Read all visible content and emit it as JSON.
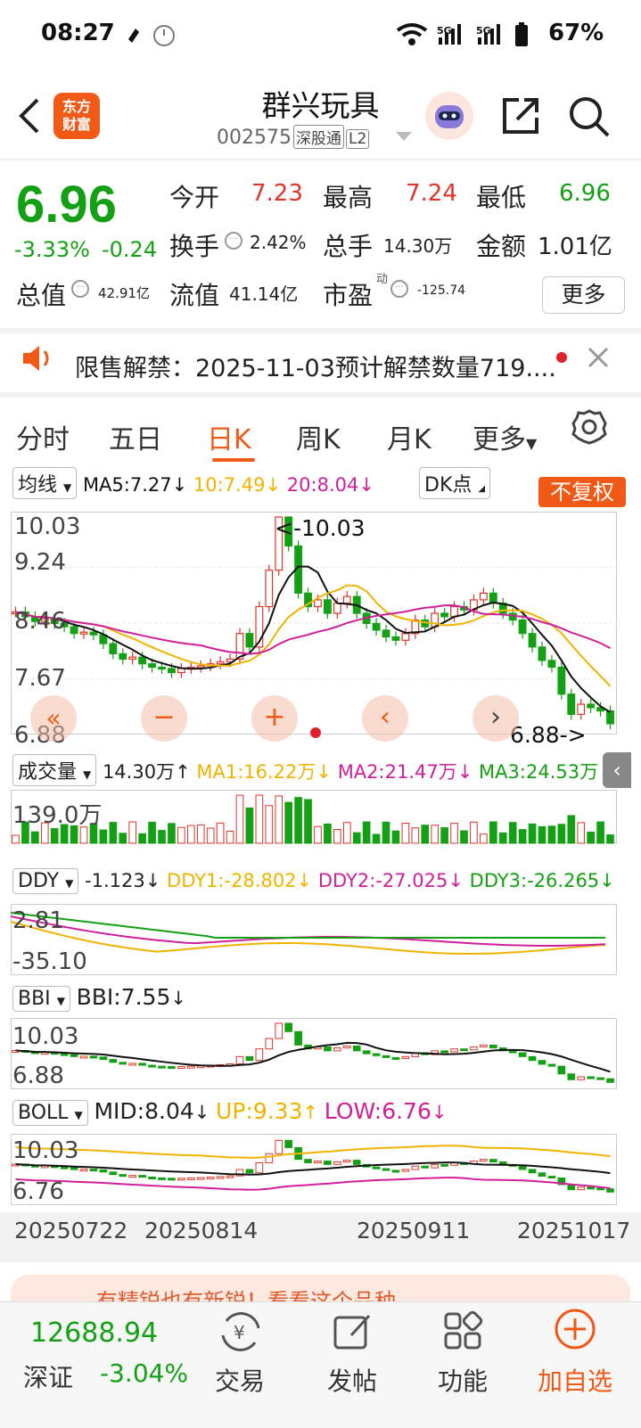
{
  "status": {
    "time": "08:27",
    "battery": "67%"
  },
  "header": {
    "title": "群兴玩具",
    "code": "002575",
    "tag1": "深股通",
    "tag2": "L2",
    "logo_l1": "东方",
    "logo_l2": "财富"
  },
  "quote": {
    "price": "6.96",
    "change_pct": "-3.33%",
    "change": "-0.24",
    "open_label": "今开",
    "open": "7.23",
    "high_label": "最高",
    "high": "7.24",
    "low_label": "最低",
    "low": "6.96",
    "turnover_label": "换手",
    "turnover": "2.42%",
    "volume_label": "总手",
    "volume": "14.30万",
    "amount_label": "金额",
    "amount": "1.01亿",
    "mktcap_label": "总值",
    "mktcap": "42.91亿",
    "float_label": "流值",
    "float": "41.14亿",
    "pe_label": "市盈",
    "pe_sup": "动",
    "pe": "-125.74",
    "more": "更多"
  },
  "notice": {
    "text": "限售解禁：2025-11-03预计解禁数量719...."
  },
  "tabs": [
    "分时",
    "五日",
    "日K",
    "周K",
    "月K",
    "更多"
  ],
  "main_chart": {
    "ma_label": "均线",
    "ma5": "MA5:7.27",
    "ma10": "10:7.49",
    "ma20": "20:8.04",
    "dk": "DK点",
    "fq": "不复权",
    "y_labels": [
      "10.03",
      "9.24",
      "8.46",
      "7.67",
      "6.88"
    ],
    "max_label": "<-10.03",
    "min_label": "6.88->"
  },
  "volume_panel": {
    "label": "成交量",
    "vol": "14.30万",
    "ma1": "MA1:16.22万",
    "ma2": "MA2:21.47万",
    "ma3": "MA3:24.53万",
    "y_label": "139.0万"
  },
  "ddy_panel": {
    "label": "DDY",
    "val": "-1.123",
    "ddy1": "DDY1:-28.802",
    "ddy2": "DDY2:-27.025",
    "ddy3": "DDY3:-26.265",
    "y_top": "2.81",
    "y_bot": "-35.10"
  },
  "bbi_panel": {
    "label": "BBI",
    "val": "BBI:7.55",
    "y_top": "10.03",
    "y_bot": "6.88"
  },
  "boll_panel": {
    "label": "BOLL",
    "mid": "MID:8.04",
    "up": "UP:9.33",
    "low": "LOW:6.76",
    "y_top": "10.03",
    "y_bot": "6.76"
  },
  "dates": [
    "20250722",
    "20250814",
    "20250911",
    "20251017"
  ],
  "banner": {
    "text": "有精锐也有新锐！看看这个品种"
  },
  "bottom": {
    "index_val": "12688.94",
    "index_name": "深证",
    "index_pct": "-3.04%",
    "nav": [
      "交易",
      "发帖",
      "功能",
      "加自选"
    ]
  },
  "colors": {
    "up": "#e0342a",
    "down": "#14a014",
    "accent": "#f05a16",
    "ma5": "#111111",
    "ma10": "#f0b400",
    "ma20": "#d0209a"
  },
  "chart_data": {
    "type": "candlestick",
    "period": "日K",
    "close": [
      8.62,
      8.55,
      8.48,
      8.52,
      8.45,
      8.4,
      8.3,
      8.32,
      8.28,
      8.15,
      8.0,
      7.92,
      7.95,
      7.85,
      7.8,
      7.78,
      7.72,
      7.78,
      7.8,
      7.82,
      7.85,
      7.88,
      7.92,
      8.3,
      8.1,
      8.7,
      9.24,
      10.03,
      9.6,
      8.9,
      8.7,
      8.8,
      8.6,
      8.75,
      8.85,
      8.6,
      8.45,
      8.35,
      8.25,
      8.2,
      8.3,
      8.5,
      8.4,
      8.6,
      8.55,
      8.7,
      8.65,
      8.8,
      8.9,
      8.75,
      8.6,
      8.5,
      8.3,
      8.1,
      7.9,
      7.8,
      7.4,
      7.1,
      7.25,
      7.2,
      7.15,
      6.96
    ],
    "volume_ylim_label": "139.0万"
  }
}
